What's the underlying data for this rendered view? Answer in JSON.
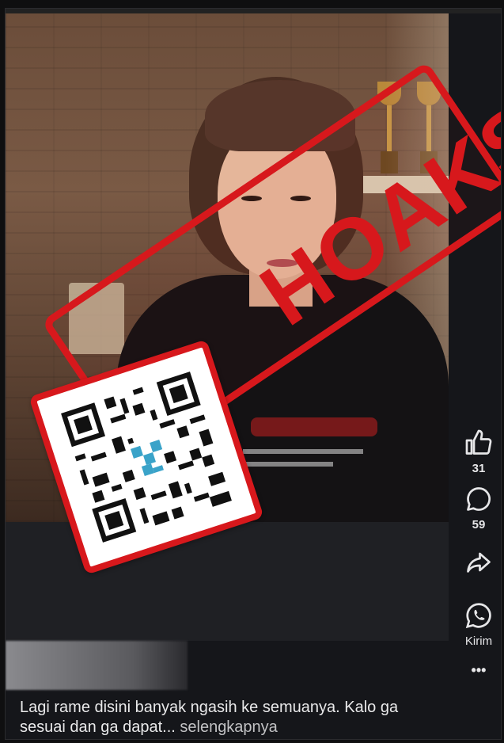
{
  "stamp": {
    "word": "HOAKS"
  },
  "post": {
    "caption_text": "Lagi rame disini banyak ngasih ke semuanya. Kalo ga sesuai dan ga dapat... ",
    "see_more_label": "selengkapnya"
  },
  "actions": {
    "like_count": "31",
    "comment_count": "59",
    "send_label": "Kirim",
    "more_label": "•••"
  },
  "colors": {
    "stamp": "#d7181c",
    "panel": "#1f2024",
    "text": "#e9e9ea"
  }
}
